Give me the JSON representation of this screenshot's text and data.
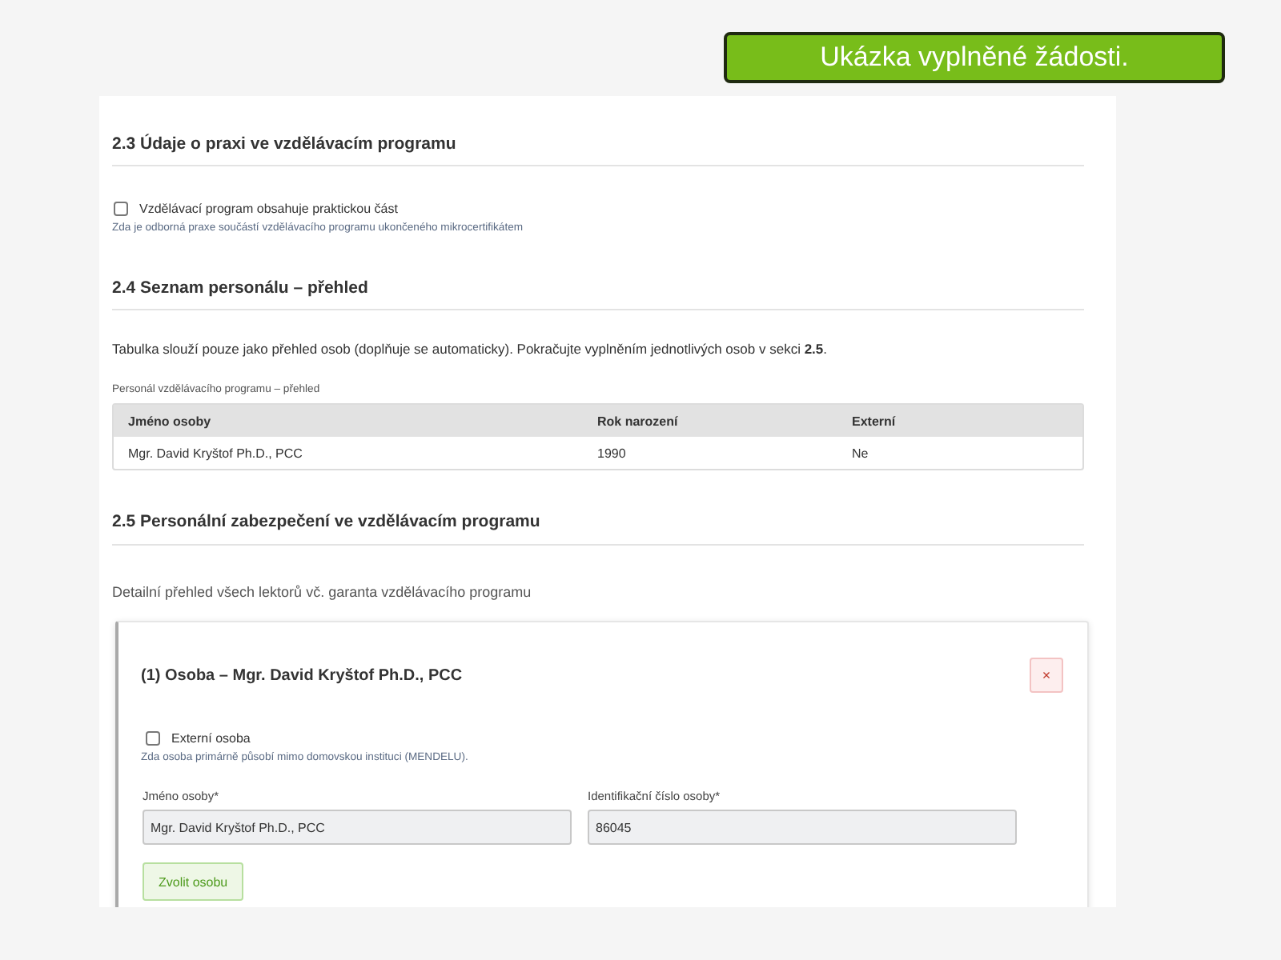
{
  "banner": {
    "text": "Ukázka vyplněné žádosti."
  },
  "section_2_3": {
    "heading": "2.3 Údaje o praxi ve vzdělávacím programu",
    "checkbox": {
      "label": "Vzdělávací program obsahuje praktickou část",
      "checked": false
    },
    "help": "Zda je odborná praxe součástí vzdělávacího programu ukončeného mikrocertifikátem"
  },
  "section_2_4": {
    "heading": "2.4 Seznam personálu – přehled",
    "intro": "Tabulka slouží pouze jako přehled osob (doplňuje se automaticky). Pokračujte vyplněním jednotlivých osob v sekci **2.5**.",
    "table": {
      "caption": "Personál vzdělávacího programu – přehled",
      "columns": [
        "Jméno osoby",
        "Rok narození",
        "Externí"
      ],
      "rows": [
        [
          "Mgr. David Kryštof Ph.D., PCC",
          "1990",
          "Ne"
        ]
      ]
    }
  },
  "section_2_5": {
    "heading": "2.5 Personální zabezpečení ve vzdělávacím programu",
    "description": "Detailní přehled všech lektorů vč. garanta vzdělávacího programu",
    "persons": [
      {
        "title": "(1) Osoba – Mgr. David Kryštof Ph.D., PCC",
        "remove_label": "×",
        "external": {
          "label": "Externí osoba",
          "checked": false,
          "help": "Zda osoba primárně působí mimo domovskou instituci (MENDELU)."
        },
        "fields": [
          {
            "label": "Jméno osoby*",
            "value": "Mgr. David Kryštof Ph.D., PCC"
          },
          {
            "label": "Identifikační číslo osoby*",
            "value": "86045"
          }
        ],
        "choose_button": "Zvolit osobu"
      }
    ]
  }
}
